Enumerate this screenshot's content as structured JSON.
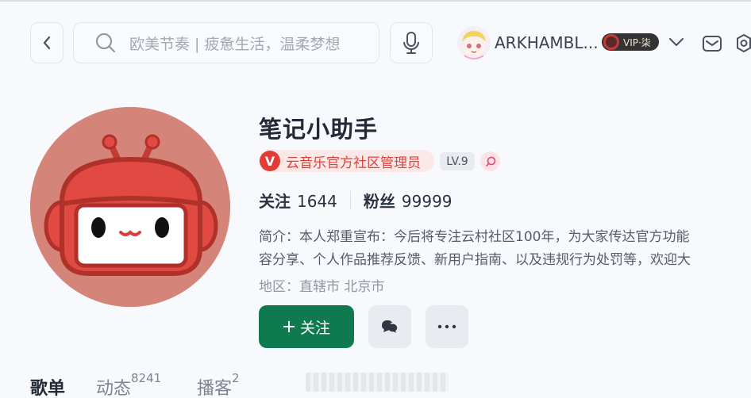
{
  "header": {
    "search_placeholder": "欧美节奏 | 疲惫生活，温柔梦想",
    "username": "ARKHAMBL...",
    "vip_label": "VIP·柒"
  },
  "profile": {
    "name": "笔记小助手",
    "admin_badge_icon": "V",
    "admin_badge": "云音乐官方社区管理员",
    "level": "LV.9",
    "following_label": "关注",
    "following_count": "1644",
    "followers_label": "粉丝",
    "followers_count": "99999",
    "intro_line1": "简介：本人郑重宣布：今后将专注云村社区100年，为大家传达官方功能",
    "intro_line2": "容分享、个人作品推荐反馈、新用户指南、以及违规行为处罚等，欢迎大",
    "region": "地区：直辖市 北京市",
    "follow_button": "关注"
  },
  "tabs": [
    {
      "label": "歌单",
      "count": ""
    },
    {
      "label": "动态",
      "count": "8241"
    },
    {
      "label": "播客",
      "count": "2"
    }
  ],
  "colors": {
    "accent": "#0f7a4f",
    "admin_red": "#e33b35",
    "avatar_bg": "#d5847a"
  }
}
